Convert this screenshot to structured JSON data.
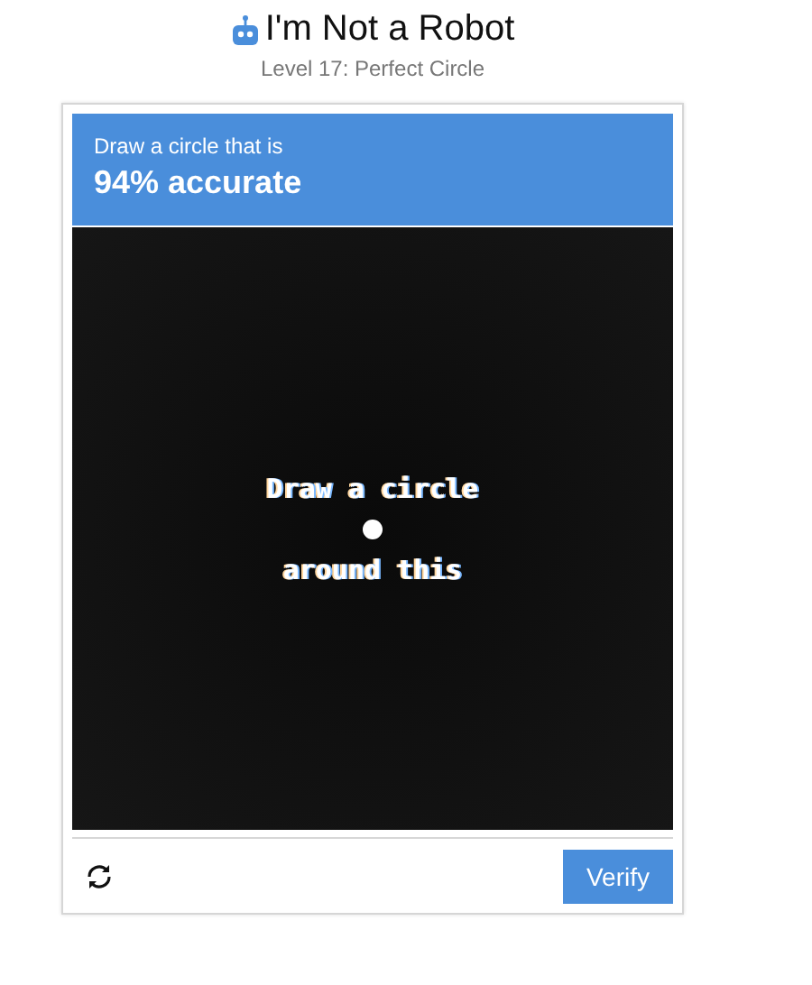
{
  "header": {
    "title": "I'm Not a Robot",
    "subtitle": "Level 17: Perfect Circle"
  },
  "challenge": {
    "instruction": "Draw a circle that is",
    "target": "94% accurate"
  },
  "canvas": {
    "line_1": "Draw a circle",
    "line_2": "around this"
  },
  "footer": {
    "verify_button": "Verify"
  }
}
